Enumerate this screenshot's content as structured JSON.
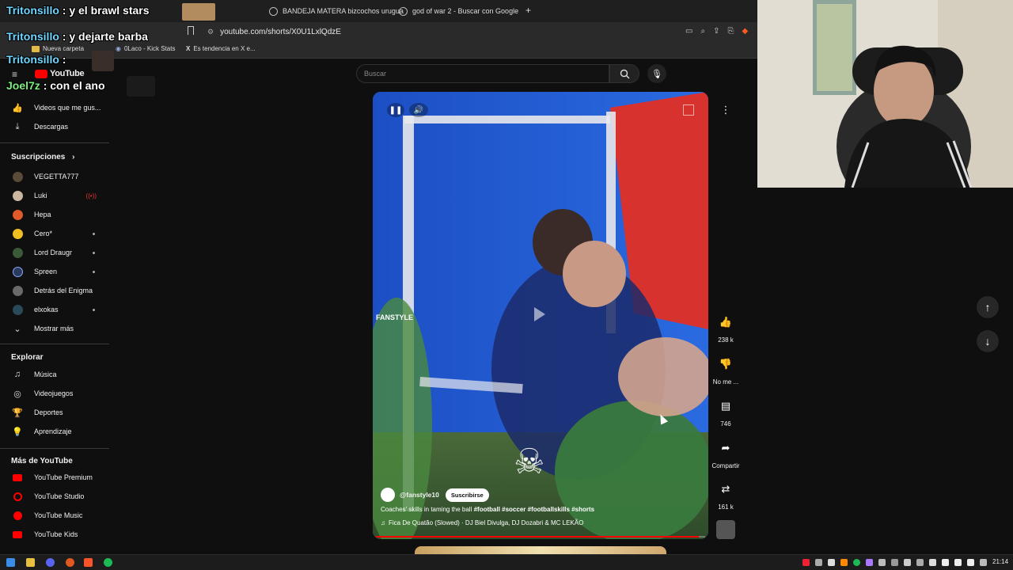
{
  "browser": {
    "tabs": [
      {
        "label": "Tritonsillo y el brawl stars",
        "x": 0
      },
      {
        "label": "BANDEJA MATERA bizcochos urugua"
      },
      {
        "label": "god of war 2 - Buscar con Google"
      }
    ],
    "url": "youtube.com/shorts/X0U1LxlQdzE",
    "bookmarks": [
      "Nueva carpeta",
      "0Laco - Kick Stats",
      "Es tendencia en X e..."
    ]
  },
  "chat": [
    {
      "user": "Tritonsillo",
      "message": "y el brawl stars"
    },
    {
      "user": "Tritonsillo",
      "message": "y dejarte barba"
    },
    {
      "user": "Tritonsillo",
      "message": ""
    },
    {
      "user": "Joel7z",
      "message": "con el ano"
    }
  ],
  "youtube": {
    "logo_text": "YouTube",
    "search_placeholder": "Buscar",
    "sidebar": {
      "top_items": [
        {
          "label": "Videos que me gus...",
          "icon": "thumbs-up-icon"
        },
        {
          "label": "Descargas",
          "icon": "download-icon"
        }
      ],
      "subscriptions_header": "Suscripciones",
      "subscriptions": [
        {
          "label": "VEGETTA777",
          "color": "#5a4a3a",
          "live": false,
          "dot": false
        },
        {
          "label": "Luki",
          "color": "#c9b7a0",
          "live": true,
          "dot": false
        },
        {
          "label": "Hepa",
          "color": "#e05a2a",
          "live": false,
          "dot": false
        },
        {
          "label": "Cero*",
          "color": "#f0c020",
          "live": false,
          "dot": true
        },
        {
          "label": "Lord Draugr",
          "color": "#3a5a3a",
          "live": false,
          "dot": true
        },
        {
          "label": "Spreen",
          "color": "#2a3a5a",
          "live": false,
          "dot": true
        },
        {
          "label": "Detrás del Enigma",
          "color": "#6a6a6a",
          "live": false,
          "dot": false
        },
        {
          "label": "elxokas",
          "color": "#2a4a5a",
          "live": false,
          "dot": true
        }
      ],
      "show_more": "Mostrar más",
      "explore_header": "Explorar",
      "explore": [
        {
          "label": "Música",
          "icon": "music-note-icon"
        },
        {
          "label": "Videojuegos",
          "icon": "gamepad-icon"
        },
        {
          "label": "Deportes",
          "icon": "trophy-icon"
        },
        {
          "label": "Aprendizaje",
          "icon": "lightbulb-icon"
        }
      ],
      "more_header": "Más de YouTube",
      "more": [
        {
          "label": "YouTube Premium"
        },
        {
          "label": "YouTube Studio"
        },
        {
          "label": "YouTube Music"
        },
        {
          "label": "YouTube Kids"
        }
      ]
    },
    "short": {
      "watermark": "FANSTYLE",
      "channel": "@fanstyle10",
      "subscribe_label": "Suscribirse",
      "caption": "Coaches' skills in taming the ball",
      "hashtags": "#football #soccer #footballskills #shorts",
      "music": "Fica De Quatão (Slowed) · DJ Biel Divulga, DJ Dozabri & MC LEKÃO",
      "progress": 0.98
    },
    "actions": {
      "likes": "238 k",
      "dislike": "No me ...",
      "comments": "746",
      "share": "Compartir",
      "remix": "161 k"
    }
  },
  "taskbar": {
    "time": "21:14"
  },
  "colors": {
    "youtube_red": "#ff0000",
    "bg": "#0f0f0f",
    "subscribe_bg": "#ffffff"
  }
}
